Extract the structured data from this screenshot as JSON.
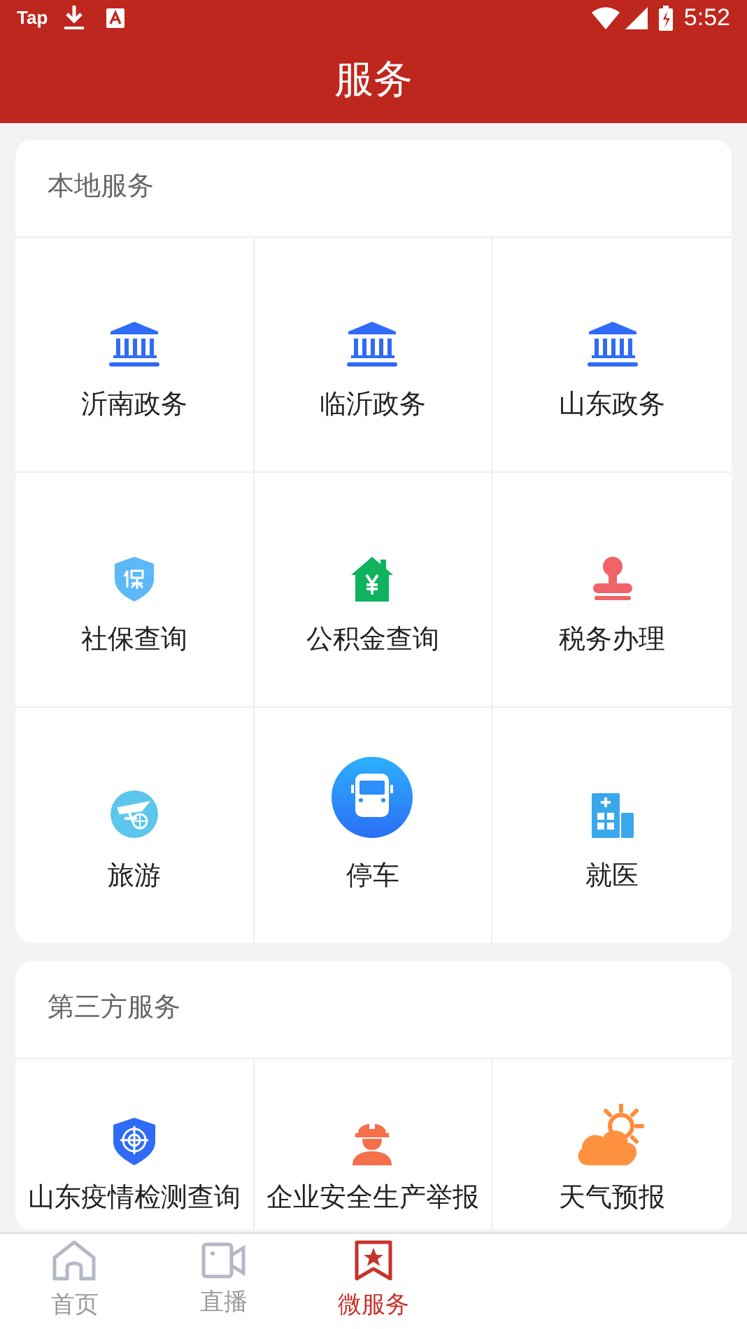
{
  "status_bar": {
    "app_label": "Tap",
    "time": "5:52"
  },
  "header": {
    "title": "服务"
  },
  "sections": [
    {
      "title": "本地服务",
      "items": [
        {
          "label": "沂南政务"
        },
        {
          "label": "临沂政务"
        },
        {
          "label": "山东政务"
        },
        {
          "label": "社保查询"
        },
        {
          "label": "公积金查询"
        },
        {
          "label": "税务办理"
        },
        {
          "label": "旅游"
        },
        {
          "label": "停车"
        },
        {
          "label": "就医"
        }
      ]
    },
    {
      "title": "第三方服务",
      "items": [
        {
          "label": "山东疫情检测查询"
        },
        {
          "label": "企业安全生产举报"
        },
        {
          "label": "天气预报"
        }
      ]
    }
  ],
  "bottom_nav": [
    {
      "label": "首页",
      "selected": false
    },
    {
      "label": "直播",
      "selected": false
    },
    {
      "label": "微服务",
      "selected": true
    }
  ]
}
